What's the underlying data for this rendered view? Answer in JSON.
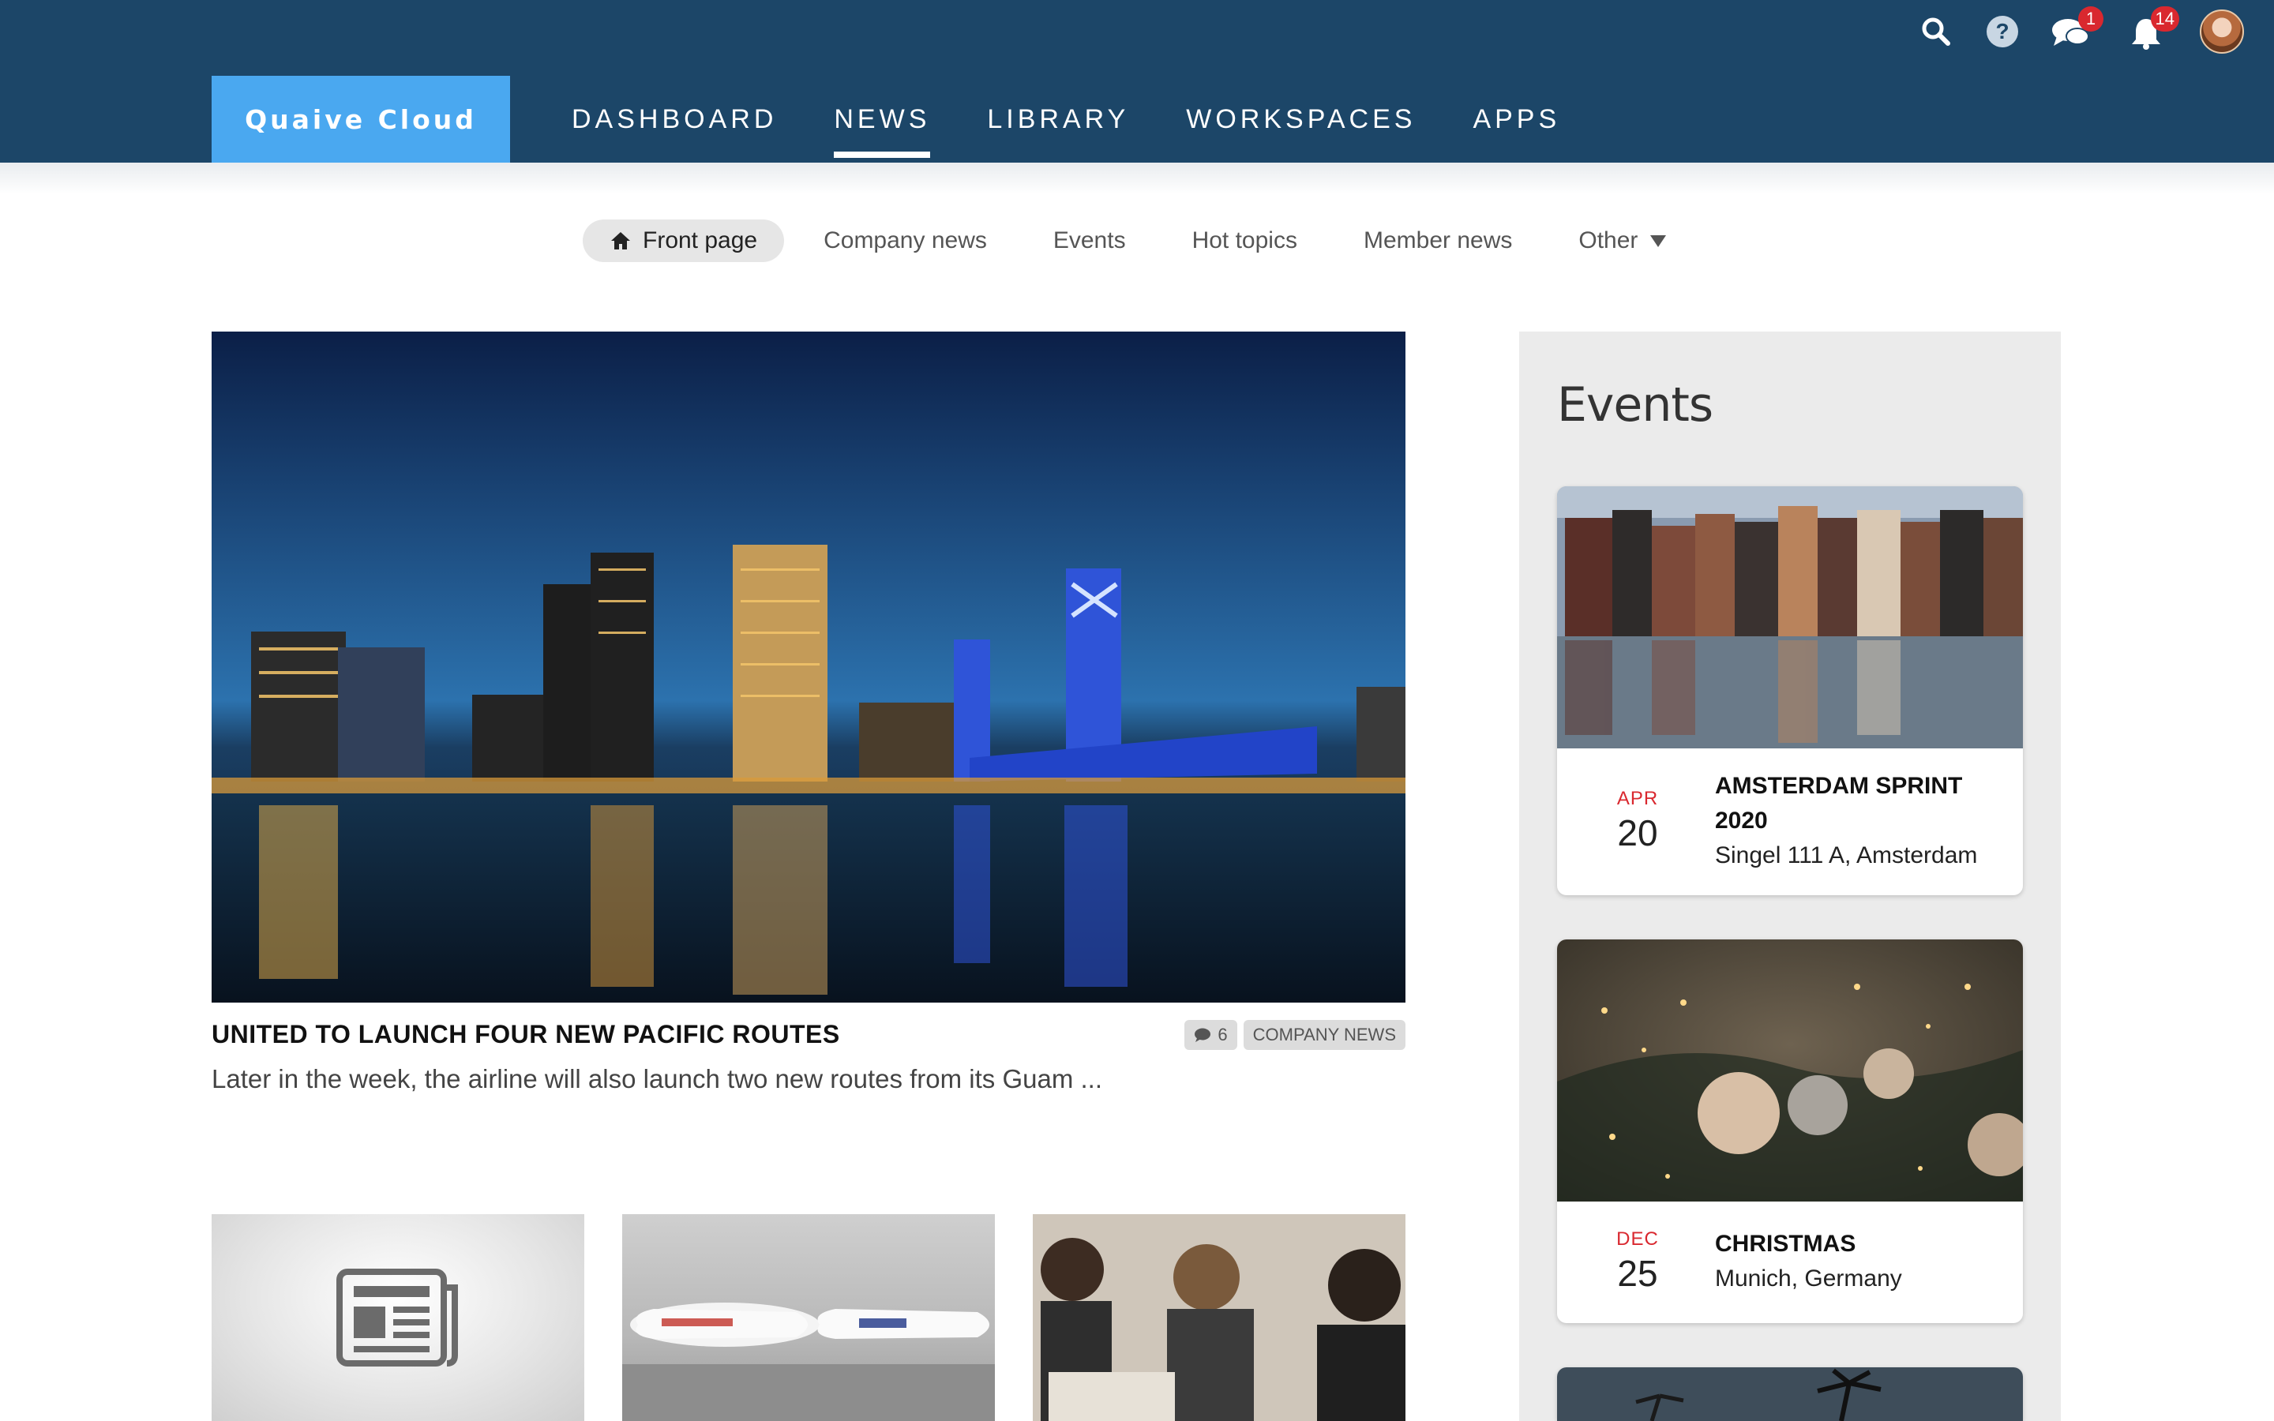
{
  "app": {
    "brand": "Quaive Cloud",
    "accent": "#4aa8f0",
    "header_bg": "#1c4668",
    "badge_color": "#d9282f"
  },
  "top_icons": [
    {
      "name": "search-icon"
    },
    {
      "name": "help-icon"
    },
    {
      "name": "messages-icon",
      "badge": "1"
    },
    {
      "name": "notifications-icon",
      "badge": "14"
    },
    {
      "name": "user-avatar"
    }
  ],
  "mainnav": [
    "DASHBOARD",
    "NEWS",
    "LIBRARY",
    "WORKSPACES",
    "APPS"
  ],
  "mainnav_active": "NEWS",
  "subnav": {
    "items": [
      "Front page",
      "Company news",
      "Events",
      "Hot topics",
      "Member news",
      "Other"
    ],
    "active": "Front page"
  },
  "featured": {
    "title": "UNITED TO LAUNCH FOUR NEW PACIFIC ROUTES",
    "comments": "6",
    "category": "COMPANY NEWS",
    "excerpt": "Later in the week, the airline will also launch two new routes from its Guam ..."
  },
  "news_thumbs": [
    {
      "icon": "newspaper-icon"
    },
    {
      "image": "airplanes-photo"
    },
    {
      "image": "team-meeting-photo"
    }
  ],
  "events": {
    "title": "Events",
    "items": [
      {
        "month": "APR",
        "day": "20",
        "title": "AMSTERDAM SPRINT 2020",
        "location": "Singel 111 A, Amsterdam"
      },
      {
        "month": "DEC",
        "day": "25",
        "title": "CHRISTMAS",
        "location": "Munich, Germany"
      }
    ]
  }
}
